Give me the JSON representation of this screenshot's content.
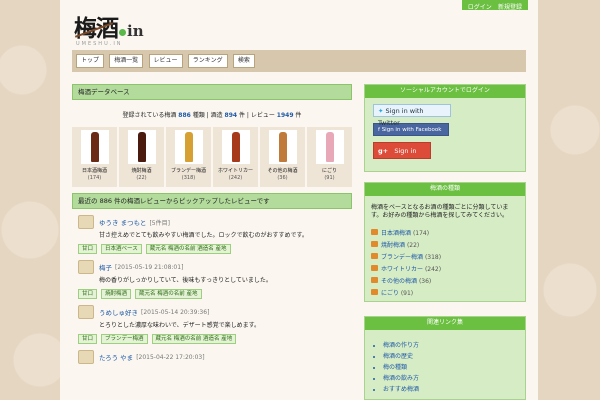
{
  "header": {
    "logo_kanji": "梅酒",
    "logo_tld": "in",
    "logo_sub": "UMESHU.IN",
    "top_links": [
      "ログイン",
      "新規登録"
    ]
  },
  "nav": [
    "トップ",
    "梅酒一覧",
    "レビュー",
    "ランキング",
    "検索"
  ],
  "overview": {
    "heading": "梅酒データベース",
    "stats_prefix": "登録されている梅酒",
    "umeshu_count": "886",
    "umeshu_unit": "種類",
    "sep1": " | ",
    "brewery_label": "酒造",
    "brewery_count": "894",
    "brewery_unit": "件",
    "sep2": " | ",
    "review_label": "レビュー",
    "review_count": "1949",
    "review_unit": "件"
  },
  "categories": [
    {
      "name": "日本酒梅酒",
      "count": "(174)",
      "color": "#6b2a14"
    },
    {
      "name": "焼酎梅酒",
      "count": "(22)",
      "color": "#4a1a0e"
    },
    {
      "name": "ブランデー梅酒",
      "count": "(318)",
      "color": "#d6a032"
    },
    {
      "name": "ホワイトリカー",
      "count": "(242)",
      "color": "#a83a1c"
    },
    {
      "name": "その他の梅酒",
      "count": "(36)",
      "color": "#c07a3a"
    },
    {
      "name": "にごり",
      "count": "(91)",
      "color": "#e8a8b8"
    }
  ],
  "reviews_head": "最近の 886 件の梅酒レビューからピックアップしたレビューです",
  "reviews": [
    {
      "user": "ゆうき まつもと",
      "date": "[5件目]",
      "text": "甘さ控えめでとても飲みやすい梅酒でした。ロックで飲むのがおすすめです。",
      "tags": [
        "甘口",
        "日本酒ベース",
        "蔵元名 梅酒の名前 酒造名 産地"
      ]
    },
    {
      "user": "梅子",
      "date": "[2015-05-19 21:08:01]",
      "text": "梅の香りがしっかりしていて、後味もすっきりとしていました。",
      "tags": [
        "甘口",
        "焼酎梅酒",
        "蔵元名 梅酒の名前 産地"
      ]
    },
    {
      "user": "うめしゅ好き",
      "date": "[2015-05-14 20:39:36]",
      "text": "とろりとした濃厚な味わいで、デザート感覚で楽しめます。",
      "tags": [
        "甘口",
        "ブランデー梅酒",
        "蔵元名 梅酒の名前 酒造名 産地"
      ]
    },
    {
      "user": "たろう やま",
      "date": "[2015-04-22 17:20:03]",
      "text": "",
      "tags": []
    }
  ],
  "sidebar": {
    "login_head": "ソーシャルアカウントでログイン",
    "twitter_btn": "Sign in with Twitter",
    "facebook_btn": "Sign in with Facebook",
    "google_btn": "Sign in",
    "google_mark": "g+",
    "about_head": "梅酒の種類",
    "about_desc": "梅酒をベースとなるお酒の種類ごとに分類しています。お好みの種類から梅酒を探してみてください。",
    "about_items": [
      {
        "label": "日本酒梅酒",
        "count": "(174)"
      },
      {
        "label": "焼酎梅酒",
        "count": "(22)"
      },
      {
        "label": "ブランデー梅酒",
        "count": "(318)"
      },
      {
        "label": "ホワイトリカー",
        "count": "(242)"
      },
      {
        "label": "その他の梅酒",
        "count": "(36)"
      },
      {
        "label": "にごり",
        "count": "(91)"
      }
    ],
    "links_head": "関連リンク集",
    "links": [
      "梅酒の作り方",
      "梅酒の歴史",
      "梅の種類",
      "梅酒の飲み方",
      "おすすめ梅酒"
    ]
  },
  "colors": {
    "accent": "#6bbf41",
    "panel_head": "#b3dc9c",
    "link": "#1f5aa8"
  }
}
